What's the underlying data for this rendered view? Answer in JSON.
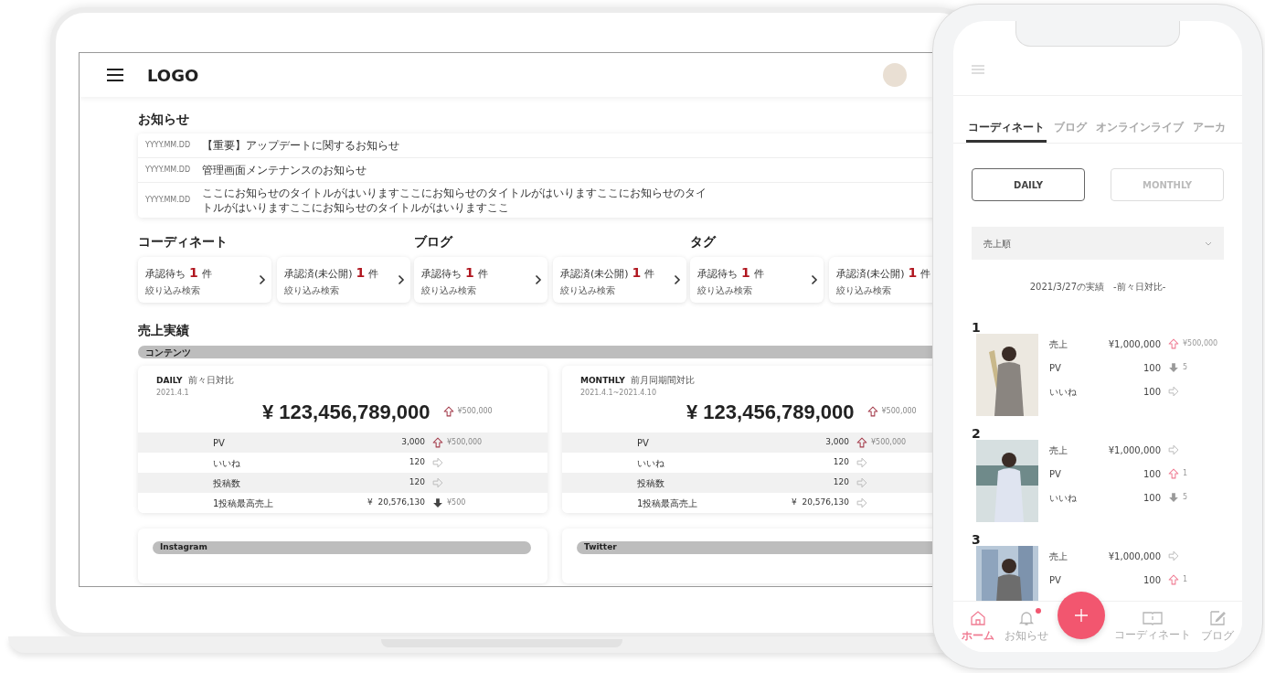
{
  "laptop": {
    "logo": "LOGO",
    "notices": {
      "title": "お知らせ",
      "items": [
        {
          "date": "YYYY.MM.DD",
          "title": "【重要】アップデートに関するお知らせ"
        },
        {
          "date": "YYYY.MM.DD",
          "title": "管理画面メンテナンスのお知らせ"
        },
        {
          "date": "YYYY.MM.DD",
          "title": "ここにお知らせのタイトルがはいりますここにお知らせのタイトルがはいりますここにお知らせのタイトルがはいりますここにお知らせのタイトルがはいりますここ"
        }
      ]
    },
    "approval_groups": [
      {
        "title": "コーディネート",
        "cards": [
          {
            "label": "承認待ち",
            "count": "1",
            "unit": "件",
            "link": "絞り込み検索"
          },
          {
            "label": "承認済(未公開)",
            "count": "1",
            "unit": "件",
            "link": "絞り込み検索"
          }
        ]
      },
      {
        "title": "ブログ",
        "cards": [
          {
            "label": "承認待ち",
            "count": "1",
            "unit": "件",
            "link": "絞り込み検索"
          },
          {
            "label": "承認済(未公開)",
            "count": "1",
            "unit": "件",
            "link": "絞り込み検索"
          }
        ]
      },
      {
        "title": "タグ",
        "cards": [
          {
            "label": "承認待ち",
            "count": "1",
            "unit": "件",
            "link": "絞り込み検索"
          },
          {
            "label": "承認済(未公開)",
            "count": "1",
            "unit": "件",
            "link": "絞り込み検索"
          }
        ]
      }
    ],
    "sales": {
      "title": "売上実績",
      "band": "コンテンツ",
      "cards": [
        {
          "period": "DAILY",
          "compare": "前々日対比",
          "date": "2021.4.1",
          "total": "¥ 123,456,789,000",
          "change": {
            "kind": "up",
            "text": "¥500,000"
          },
          "rows": [
            {
              "label": "PV",
              "value": "3,000",
              "change": {
                "kind": "up",
                "text": "¥500,000"
              }
            },
            {
              "label": "いいね",
              "value": "120",
              "change": {
                "kind": "flat"
              }
            },
            {
              "label": "投稿数",
              "value": "120",
              "change": {
                "kind": "flat"
              }
            },
            {
              "label": "1投稿最高売上",
              "value": "¥  20,576,130",
              "change": {
                "kind": "down",
                "text": "¥500"
              }
            }
          ]
        },
        {
          "period": "MONTHLY",
          "compare": "前月同期間対比",
          "date": "2021.4.1~2021.4.10",
          "total": "¥ 123,456,789,000",
          "change": {
            "kind": "up",
            "text": "¥500,000"
          },
          "rows": [
            {
              "label": "PV",
              "value": "3,000",
              "change": {
                "kind": "up",
                "text": "¥500,000"
              }
            },
            {
              "label": "いいね",
              "value": "120",
              "change": {
                "kind": "flat"
              }
            },
            {
              "label": "投稿数",
              "value": "120",
              "change": {
                "kind": "flat"
              }
            },
            {
              "label": "1投稿最高売上",
              "value": "¥  20,576,130",
              "change": {
                "kind": "flat"
              }
            }
          ]
        }
      ]
    },
    "social": [
      {
        "label": "Instagram"
      },
      {
        "label": "Twitter"
      }
    ]
  },
  "phone": {
    "tabs": [
      {
        "label": "コーディネート",
        "selected": true
      },
      {
        "label": "ブログ",
        "selected": false
      },
      {
        "label": "オンラインライブ",
        "selected": false
      },
      {
        "label": "アーカ",
        "selected": false
      }
    ],
    "periods": [
      {
        "label": "DAILY",
        "selected": true
      },
      {
        "label": "MONTHLY",
        "selected": false
      }
    ],
    "sort": {
      "value": "売上順"
    },
    "heading": "2021/3/27の実績　-前々日対比-",
    "ranking": [
      {
        "rank": "1",
        "metrics": [
          {
            "label": "売上",
            "value": "¥1,000,000",
            "change": {
              "kind": "up",
              "text": "¥500,000"
            }
          },
          {
            "label": "PV",
            "value": "100",
            "change": {
              "kind": "down",
              "text": "5"
            }
          },
          {
            "label": "いいね",
            "value": "100",
            "change": {
              "kind": "flat"
            }
          }
        ]
      },
      {
        "rank": "2",
        "metrics": [
          {
            "label": "売上",
            "value": "¥1,000,000",
            "change": {
              "kind": "flat"
            }
          },
          {
            "label": "PV",
            "value": "100",
            "change": {
              "kind": "up",
              "text": "1"
            }
          },
          {
            "label": "いいね",
            "value": "100",
            "change": {
              "kind": "down",
              "text": "5"
            }
          }
        ]
      },
      {
        "rank": "3",
        "metrics": [
          {
            "label": "売上",
            "value": "¥1,000,000",
            "change": {
              "kind": "flat"
            }
          },
          {
            "label": "PV",
            "value": "100",
            "change": {
              "kind": "up",
              "text": "1"
            }
          }
        ]
      }
    ],
    "nav": [
      {
        "kind": "home",
        "label": "ホーム",
        "selected": true,
        "badge": false
      },
      {
        "kind": "bell",
        "label": "お知らせ",
        "selected": false,
        "badge": true
      },
      {
        "kind": "add"
      },
      {
        "kind": "book",
        "label": "コーディネート",
        "selected": false,
        "badge": false
      },
      {
        "kind": "edit",
        "label": "ブログ",
        "selected": false,
        "badge": false
      }
    ]
  }
}
